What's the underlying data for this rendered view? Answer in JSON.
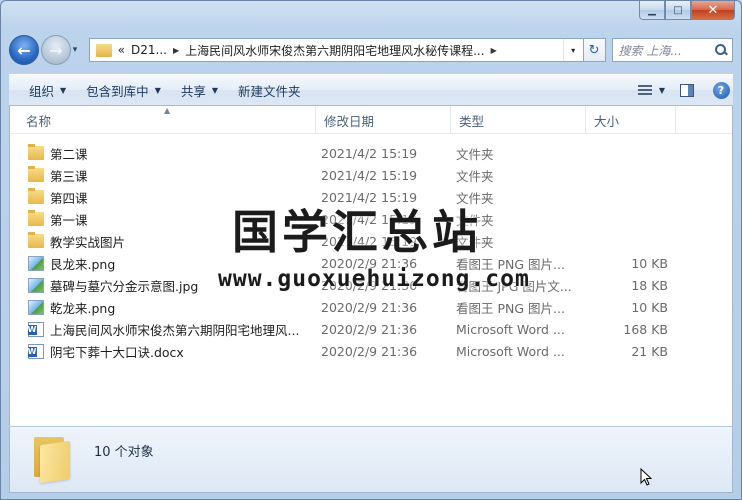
{
  "window": {
    "caption_buttons": {
      "minimize": "▁",
      "maximize": "□",
      "close": "✕"
    }
  },
  "nav": {
    "back_glyph": "←",
    "forward_glyph": "→",
    "history_glyph": "▾",
    "breadcrumb_overflow": "«",
    "breadcrumbs": [
      "D21...",
      "上海民间风水师宋俊杰第六期阴阳宅地理风水秘传课程..."
    ],
    "address_drop_glyph": "▾",
    "refresh_glyph": "↻",
    "search_placeholder": "搜索 上海..."
  },
  "toolbar": {
    "organize": "组织",
    "include_in_library": "包含到库中",
    "share": "共享",
    "new_folder": "新建文件夹",
    "arrow_glyph": "▼",
    "help_glyph": "?"
  },
  "columns": {
    "name": "名称",
    "modified": "修改日期",
    "type": "类型",
    "size": "大小",
    "sort_glyph": "▲"
  },
  "files": [
    {
      "name": "第二课",
      "modified": "2021/4/2 15:19",
      "type": "文件夹",
      "size": "",
      "icon": "folder-icon"
    },
    {
      "name": "第三课",
      "modified": "2021/4/2 15:19",
      "type": "文件夹",
      "size": "",
      "icon": "folder-icon"
    },
    {
      "name": "第四课",
      "modified": "2021/4/2 15:19",
      "type": "文件夹",
      "size": "",
      "icon": "folder-icon"
    },
    {
      "name": "第一课",
      "modified": "2021/4/2 15:19",
      "type": "文件夹",
      "size": "",
      "icon": "folder-icon"
    },
    {
      "name": "教学实战图片",
      "modified": "2021/4/2 15:19",
      "type": "文件夹",
      "size": "",
      "icon": "folder-icon"
    },
    {
      "name": "艮龙来.png",
      "modified": "2020/2/9 21:36",
      "type": "看图王 PNG 图片...",
      "size": "10 KB",
      "icon": "image-icon"
    },
    {
      "name": "墓碑与墓穴分金示意图.jpg",
      "modified": "2020/2/9 21:36",
      "type": "看图王 JPG 图片文...",
      "size": "18 KB",
      "icon": "image-icon"
    },
    {
      "name": "乾龙来.png",
      "modified": "2020/2/9 21:36",
      "type": "看图王 PNG 图片...",
      "size": "10 KB",
      "icon": "image-icon"
    },
    {
      "name": "上海民间风水师宋俊杰第六期阴阳宅地理风...",
      "modified": "2020/2/9 21:36",
      "type": "Microsoft Word ...",
      "size": "168 KB",
      "icon": "word-doc-icon"
    },
    {
      "name": "阴宅下葬十大口诀.docx",
      "modified": "2020/2/9 21:36",
      "type": "Microsoft Word ...",
      "size": "21 KB",
      "icon": "word-doc-icon"
    }
  ],
  "watermark": {
    "title": "国学汇总站",
    "url": "www.guoxuehuizong.com"
  },
  "details": {
    "count": "10 个对象"
  }
}
